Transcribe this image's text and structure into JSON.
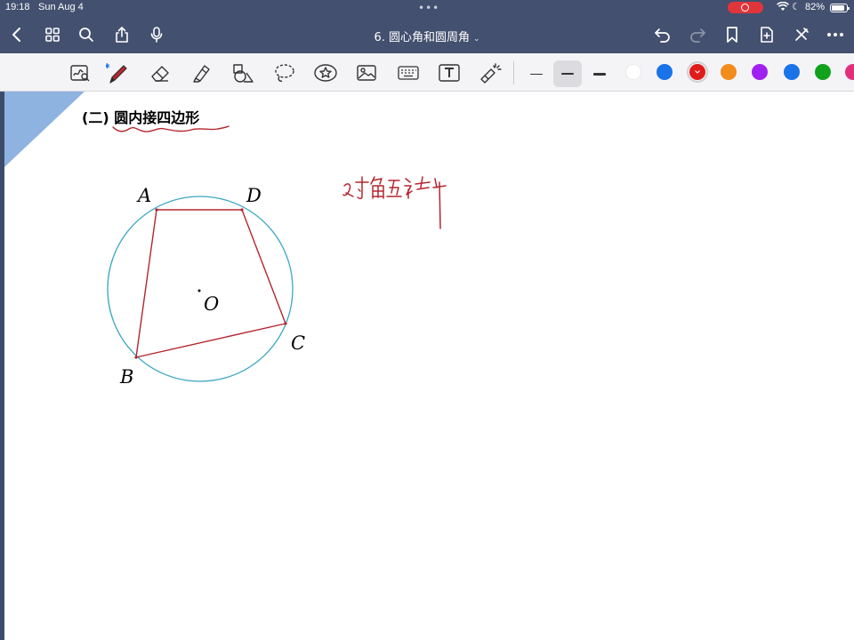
{
  "status_bar": {
    "time": "19:18",
    "date": "Sun Aug 4",
    "battery_percent": "82%"
  },
  "app_bar": {
    "document_title": "6. 圆心角和圆周角",
    "icons": [
      "back-icon",
      "grid-icon",
      "search-icon",
      "share-icon",
      "microphone-icon",
      "undo-icon",
      "redo-icon",
      "bookmark-icon",
      "add-page-icon",
      "close-pen-icon",
      "more-icon"
    ]
  },
  "toolbar": {
    "tools": [
      "zoom-writing-tool",
      "pen-tool",
      "eraser-tool",
      "highlighter-tool",
      "shapes-tool",
      "lasso-tool",
      "sticker-tool",
      "image-tool",
      "keyboard-tool",
      "text-tool",
      "laser-pointer-tool"
    ],
    "selected_tool": "pen-tool",
    "stroke_widths": [
      "thin",
      "medium",
      "thick"
    ],
    "selected_stroke": "medium",
    "colors": [
      "#ffffff",
      "#1a73e8",
      "#e01b1b",
      "#f28c1b",
      "#a020f0",
      "#1a73e8",
      "#12a11b",
      "#e0307a"
    ],
    "selected_color": "#e01b1b"
  },
  "page": {
    "heading": "(二) 圆内接四边形",
    "diagram": {
      "points": {
        "A": "A",
        "B": "B",
        "C": "C",
        "D": "D",
        "O": "O"
      },
      "circle_color": "#3aa6c2",
      "quad_color": "#b3262e"
    },
    "handwritten_note_color": "#b3262e",
    "accent_triangle_color": "#8fb3e0"
  }
}
